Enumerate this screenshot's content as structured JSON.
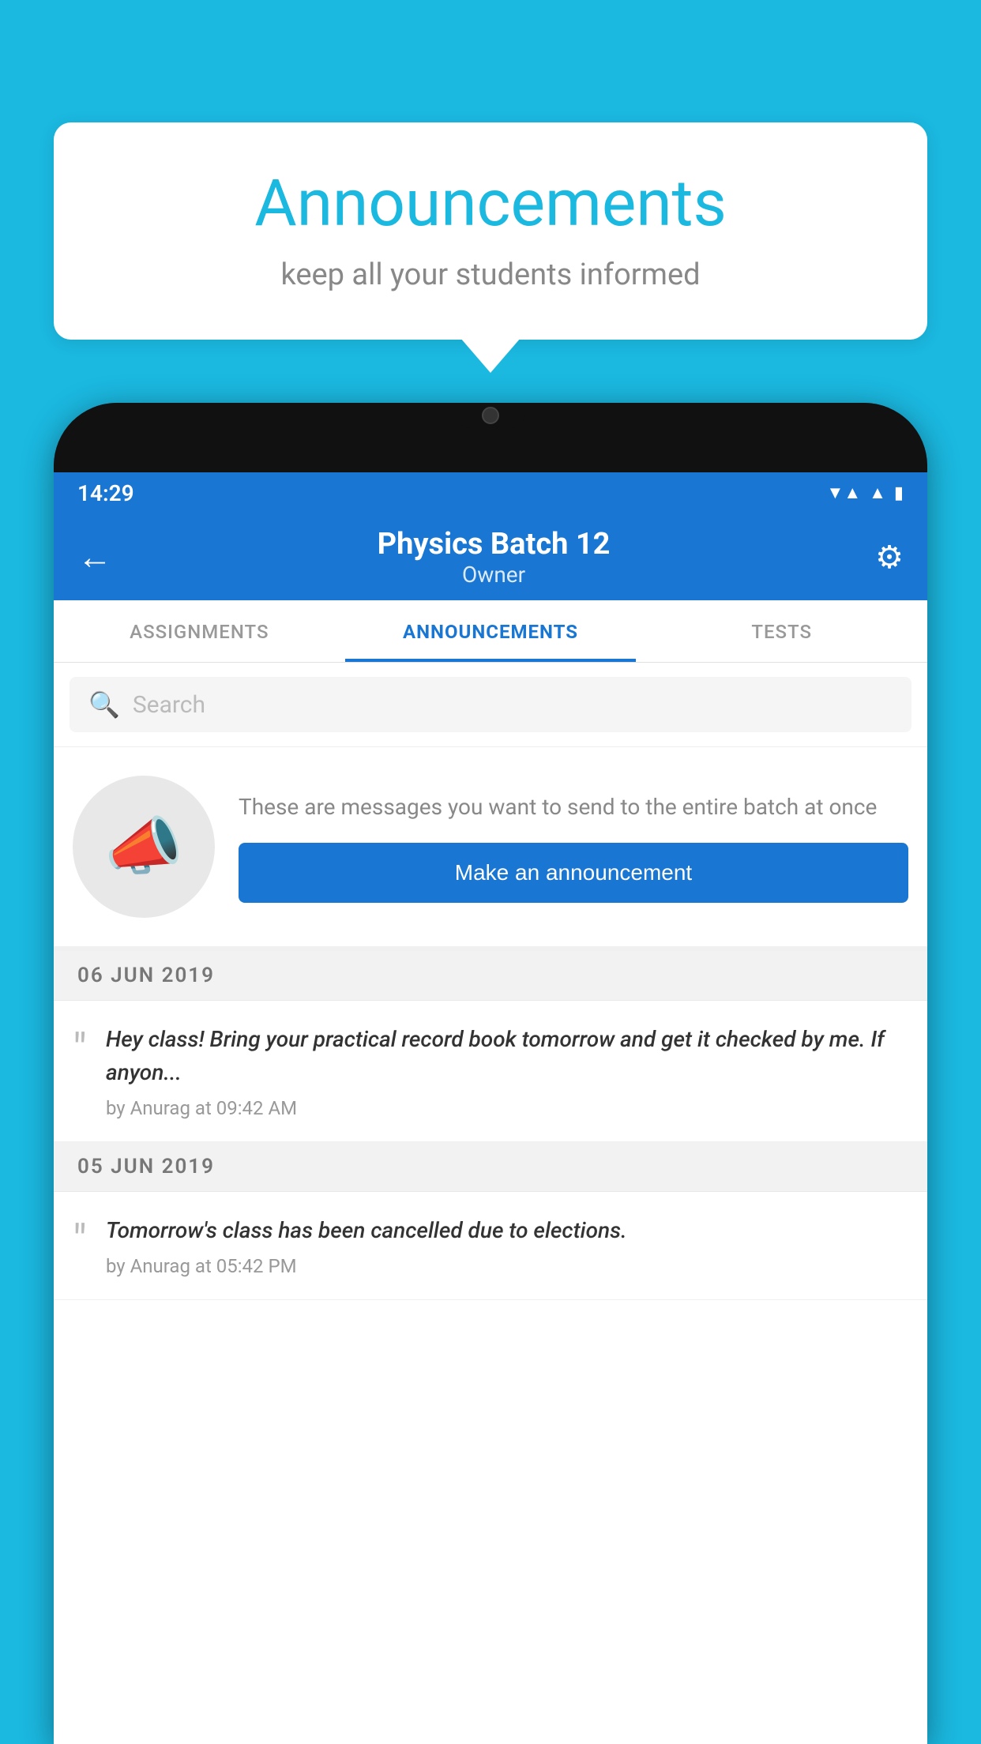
{
  "background_color": "#1bb8e0",
  "speech_bubble": {
    "title": "Announcements",
    "subtitle": "keep all your students informed"
  },
  "phone": {
    "status_bar": {
      "time": "14:29",
      "icons": [
        "wifi",
        "signal",
        "battery"
      ]
    },
    "header": {
      "title": "Physics Batch 12",
      "subtitle": "Owner",
      "back_label": "←",
      "settings_label": "⚙"
    },
    "tabs": [
      {
        "label": "ASSIGNMENTS",
        "active": false
      },
      {
        "label": "ANNOUNCEMENTS",
        "active": true
      },
      {
        "label": "TESTS",
        "active": false
      }
    ],
    "search": {
      "placeholder": "Search"
    },
    "announcement_prompt": {
      "description": "These are messages you want to send to the entire batch at once",
      "button_label": "Make an announcement"
    },
    "announcements": [
      {
        "date": "06  JUN  2019",
        "text": "Hey class! Bring your practical record book tomorrow and get it checked by me. If anyon...",
        "meta": "by Anurag at 09:42 AM"
      },
      {
        "date": "05  JUN  2019",
        "text": "Tomorrow's class has been cancelled due to elections.",
        "meta": "by Anurag at 05:42 PM"
      }
    ]
  }
}
